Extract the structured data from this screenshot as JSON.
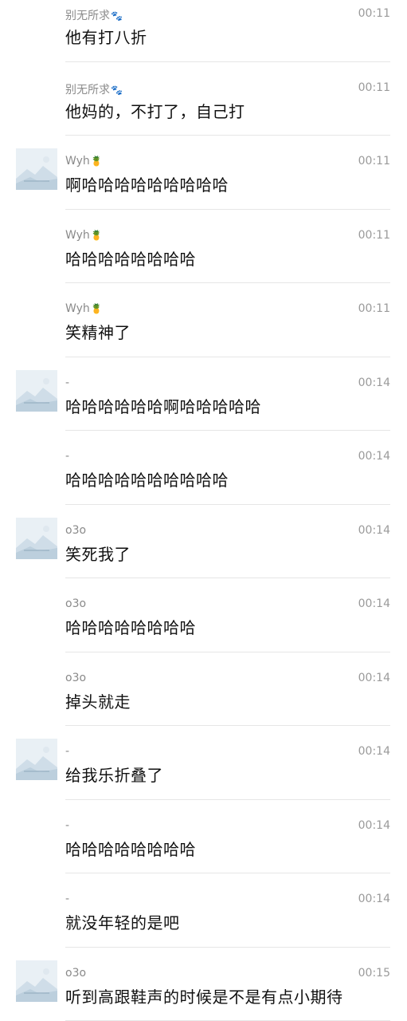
{
  "messages": [
    {
      "sender": "别无所求",
      "emoji": "🐾",
      "time": "00:11",
      "text": "他有打八折",
      "avatar": false
    },
    {
      "sender": "别无所求",
      "emoji": "🐾",
      "time": "00:11",
      "text": "他妈的，不打了，自己打",
      "avatar": false
    },
    {
      "sender": "Wyh",
      "emoji": "🍍",
      "time": "00:11",
      "text": "啊哈哈哈哈哈哈哈哈哈",
      "avatar": true
    },
    {
      "sender": "Wyh",
      "emoji": "🍍",
      "time": "00:11",
      "text": "哈哈哈哈哈哈哈哈",
      "avatar": false
    },
    {
      "sender": "Wyh",
      "emoji": "🍍",
      "time": "00:11",
      "text": "笑精神了",
      "avatar": false
    },
    {
      "sender": "-",
      "emoji": "",
      "time": "00:14",
      "text": "哈哈哈哈哈哈啊哈哈哈哈哈",
      "avatar": true
    },
    {
      "sender": "-",
      "emoji": "",
      "time": "00:14",
      "text": "哈哈哈哈哈哈哈哈哈哈",
      "avatar": false
    },
    {
      "sender": "o3o",
      "emoji": "",
      "time": "00:14",
      "text": "笑死我了",
      "avatar": true
    },
    {
      "sender": "o3o",
      "emoji": "",
      "time": "00:14",
      "text": "哈哈哈哈哈哈哈哈",
      "avatar": false
    },
    {
      "sender": "o3o",
      "emoji": "",
      "time": "00:14",
      "text": "掉头就走",
      "avatar": false
    },
    {
      "sender": "-",
      "emoji": "",
      "time": "00:14",
      "text": "给我乐折叠了",
      "avatar": true
    },
    {
      "sender": "-",
      "emoji": "",
      "time": "00:14",
      "text": "哈哈哈哈哈哈哈哈",
      "avatar": false
    },
    {
      "sender": "-",
      "emoji": "",
      "time": "00:14",
      "text": "就没年轻的是吧",
      "avatar": false
    },
    {
      "sender": "o3o",
      "emoji": "",
      "time": "00:15",
      "text": "听到高跟鞋声的时候是不是有点小期待",
      "avatar": true
    }
  ],
  "colors": {
    "sender": "#8a8a8a",
    "time": "#9a9a9a",
    "text": "#111111",
    "divider": "#e6e6e6",
    "avatar_bg": "#e9f0f5"
  },
  "icons": {
    "avatar": "image-placeholder-icon"
  }
}
